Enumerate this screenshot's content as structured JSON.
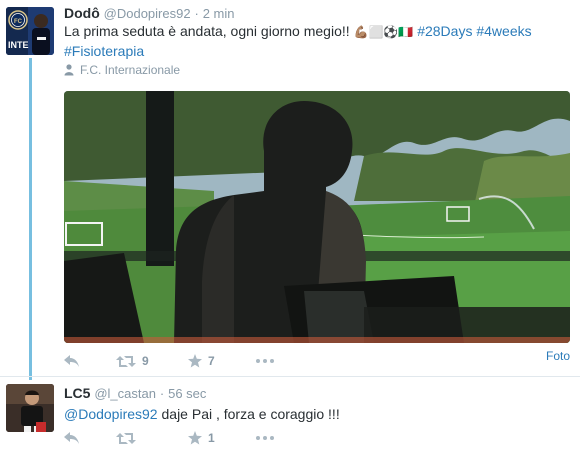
{
  "tweets": [
    {
      "name": "Dodô",
      "handle": "@Dodopires92",
      "separator": "·",
      "time": "2 min",
      "text_plain": "La prima seduta è andata, ogni giorno megio!! ",
      "emoji": "💪🏽⬜⚽🇮🇹",
      "hashtags": [
        "#28Days",
        "#4weeks",
        "#Fisioterapia"
      ],
      "context_label": "F.C. Internazionale",
      "photo_label": "Foto",
      "retweet_count": "9",
      "favorite_count": "7"
    },
    {
      "name": "LC5",
      "handle": "@l_castan",
      "separator": "·",
      "time": "56 sec",
      "mention": "@Dodopires92",
      "text_plain": " daje Pai , forza e coraggio !!!",
      "retweet_count": "",
      "favorite_count": "1"
    }
  ],
  "avatar_text": {
    "inter_logo_letters": "INTER",
    "inter_label": "INTE"
  },
  "colors": {
    "link": "#2b7bb9",
    "muted": "#8899a6",
    "thread_line": "#77bfe0",
    "inter_blue": "#1e3b73"
  },
  "icons": [
    "reply-icon",
    "retweet-icon",
    "favorite-icon",
    "more-icon",
    "person-icon"
  ]
}
